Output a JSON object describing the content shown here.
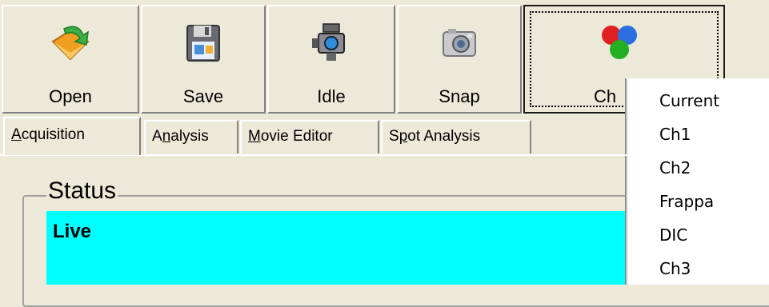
{
  "toolbar": {
    "buttons": [
      {
        "label": "Open",
        "icon": "open-folder-icon"
      },
      {
        "label": "Save",
        "icon": "floppy-disk-icon"
      },
      {
        "label": "Idle",
        "icon": "video-camera-icon"
      },
      {
        "label": "Snap",
        "icon": "photo-camera-icon"
      },
      {
        "label": "Ch",
        "icon": "color-channels-icon"
      }
    ]
  },
  "tabs": [
    {
      "label": "Acquisition",
      "mnemonic": "A"
    },
    {
      "label": "Analysis",
      "mnemonic": "n"
    },
    {
      "label": "Movie Editor",
      "mnemonic": "M"
    },
    {
      "label": "Spot Analysis",
      "mnemonic": "p"
    }
  ],
  "status": {
    "group_title": "Status",
    "text": "Live",
    "color": "#00ffff"
  },
  "channel_menu": {
    "items": [
      "Current",
      "Ch1",
      "Ch2",
      "Frappa",
      "DIC",
      "Ch3"
    ]
  }
}
